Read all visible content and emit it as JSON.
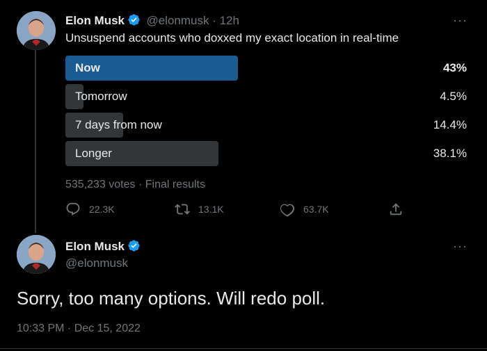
{
  "colors": {
    "background": "#000000",
    "text": "#e7e9ea",
    "secondary_text": "#71767b",
    "poll_winner_bar": "#1a5b91",
    "poll_bar": "#333639",
    "verified_badge": "#1d9bf0"
  },
  "tweet1": {
    "author_name": "Elon Musk",
    "handle": "@elonmusk",
    "time": " · 12h",
    "more": "···",
    "text": "Unsuspend accounts who doxxed my exact location in real-time",
    "poll": {
      "options": [
        {
          "label": "Now",
          "percent_label": "43%",
          "percent": 43.0,
          "winner": true
        },
        {
          "label": "Tomorrow",
          "percent_label": "4.5%",
          "percent": 4.5,
          "winner": false
        },
        {
          "label": "7 days from now",
          "percent_label": "14.4%",
          "percent": 14.4,
          "winner": false
        },
        {
          "label": "Longer",
          "percent_label": "38.1%",
          "percent": 38.1,
          "winner": false
        }
      ],
      "summary": "535,233 votes · Final results"
    },
    "actions": {
      "reply_icon": "reply-icon",
      "reply_count": "22.3K",
      "retweet_icon": "retweet-icon",
      "retweet_count": "13.1K",
      "like_icon": "heart-icon",
      "like_count": "63.7K",
      "share_icon": "share-icon"
    }
  },
  "tweet2": {
    "author_name": "Elon Musk",
    "handle": "@elonmusk",
    "more": "···",
    "text": "Sorry, too many options. Will redo poll.",
    "timestamp": "10:33 PM · Dec 15, 2022"
  }
}
